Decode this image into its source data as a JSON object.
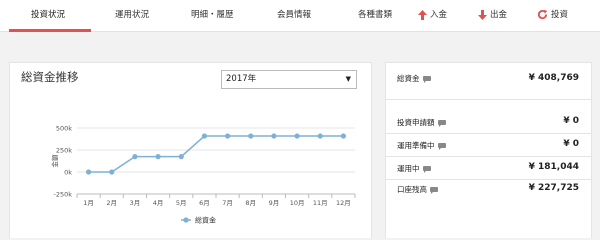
{
  "nav": {
    "tabs": [
      {
        "label": "投資状況",
        "active": true
      },
      {
        "label": "運用状況"
      },
      {
        "label": "明細・履歴"
      },
      {
        "label": "会員情報"
      },
      {
        "label": "各種書類"
      }
    ],
    "actions": [
      {
        "label": "入金",
        "icon": "arrow-up-icon"
      },
      {
        "label": "出金",
        "icon": "arrow-down-icon"
      },
      {
        "label": "投資",
        "icon": "refresh-icon"
      }
    ],
    "accent_color": "#e05252"
  },
  "chart_panel": {
    "title": "総資金推移",
    "year_select": {
      "value": "2017年"
    }
  },
  "chart_data": {
    "type": "line",
    "x": [
      "1月",
      "2月",
      "3月",
      "4月",
      "5月",
      "6月",
      "7月",
      "8月",
      "9月",
      "10月",
      "11月",
      "12月"
    ],
    "series": [
      {
        "name": "総資金",
        "values": [
          0,
          0,
          175000,
          175000,
          175000,
          408769,
          408769,
          408769,
          408769,
          408769,
          408769,
          408769
        ],
        "color": "#7fb0d6"
      }
    ],
    "ylabel": "金額",
    "yticks": [
      "500k",
      "250k",
      "0k",
      "-250k"
    ],
    "ylim": [
      -250000,
      500000
    ],
    "grid": true,
    "legend": "bottom"
  },
  "summary": {
    "total": {
      "label": "総資金",
      "value": "¥ 408,769"
    },
    "items": [
      {
        "label": "投資申請額",
        "value": "¥ 0"
      },
      {
        "label": "運用準備中",
        "value": "¥ 0"
      },
      {
        "label": "運用中",
        "value": "¥ 181,044"
      },
      {
        "label": "口座残高",
        "value": "¥ 227,725"
      }
    ]
  }
}
